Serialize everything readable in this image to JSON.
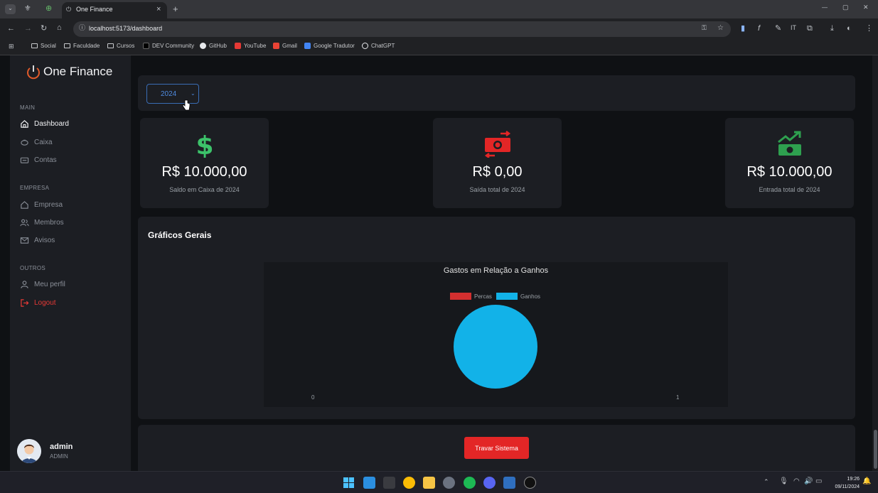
{
  "browser": {
    "tab_title": "One Finance",
    "url": "localhost:5173/dashboard",
    "bookmarks": [
      "Social",
      "Faculdade",
      "Cursos",
      "DEV Community",
      "GitHub",
      "YouTube",
      "Gmail",
      "Google Tradutor",
      "ChatGPT"
    ],
    "new_tab": "+",
    "close_tab": "×",
    "win_min": "—",
    "win_max": "▢",
    "win_close": "✕"
  },
  "sidebar": {
    "brand": "One Finance",
    "sections": {
      "main": "MAIN",
      "empresa": "EMPRESA",
      "outros": "OUTROS"
    },
    "items": [
      {
        "label": "Dashboard",
        "icon": "home-icon"
      },
      {
        "label": "Caixa",
        "icon": "piggy-bank-icon"
      },
      {
        "label": "Contas",
        "icon": "wallet-icon"
      },
      {
        "label": "Empresa",
        "icon": "building-icon"
      },
      {
        "label": "Membros",
        "icon": "users-icon"
      },
      {
        "label": "Avisos",
        "icon": "mail-icon"
      },
      {
        "label": "Meu perfil",
        "icon": "user-icon"
      },
      {
        "label": "Logout",
        "icon": "logout-icon"
      }
    ],
    "user": {
      "name": "admin",
      "role": "ADMIN"
    }
  },
  "filter": {
    "year": "2024",
    "chevron": "⌄"
  },
  "cards": [
    {
      "value": "R$ 10.000,00",
      "caption": "Saldo em Caixa de 2024",
      "icon": "dollar-icon",
      "color": "#3cc26a"
    },
    {
      "value": "R$ 0,00",
      "caption": "Saída total de 2024",
      "icon": "money-transfer-icon",
      "color": "#e32626"
    },
    {
      "value": "R$ 10.000,00",
      "caption": "Entrada total de 2024",
      "icon": "money-growth-icon",
      "color": "#2ea04f"
    }
  ],
  "charts_section": {
    "title": "Gráficos Gerais"
  },
  "chart_data": {
    "type": "pie",
    "title": "Gastos em Relação a Ganhos",
    "categories": [
      "Percas",
      "Ganhos"
    ],
    "values": [
      0,
      10000
    ],
    "colors": [
      "#d32f2f",
      "#12b2e8"
    ],
    "x_ticks": [
      "0",
      "1"
    ],
    "legend": "top"
  },
  "actions": {
    "lock_label": "Travar Sistema"
  },
  "taskbar": {
    "time": "19:26",
    "date": "09/11/2024"
  }
}
